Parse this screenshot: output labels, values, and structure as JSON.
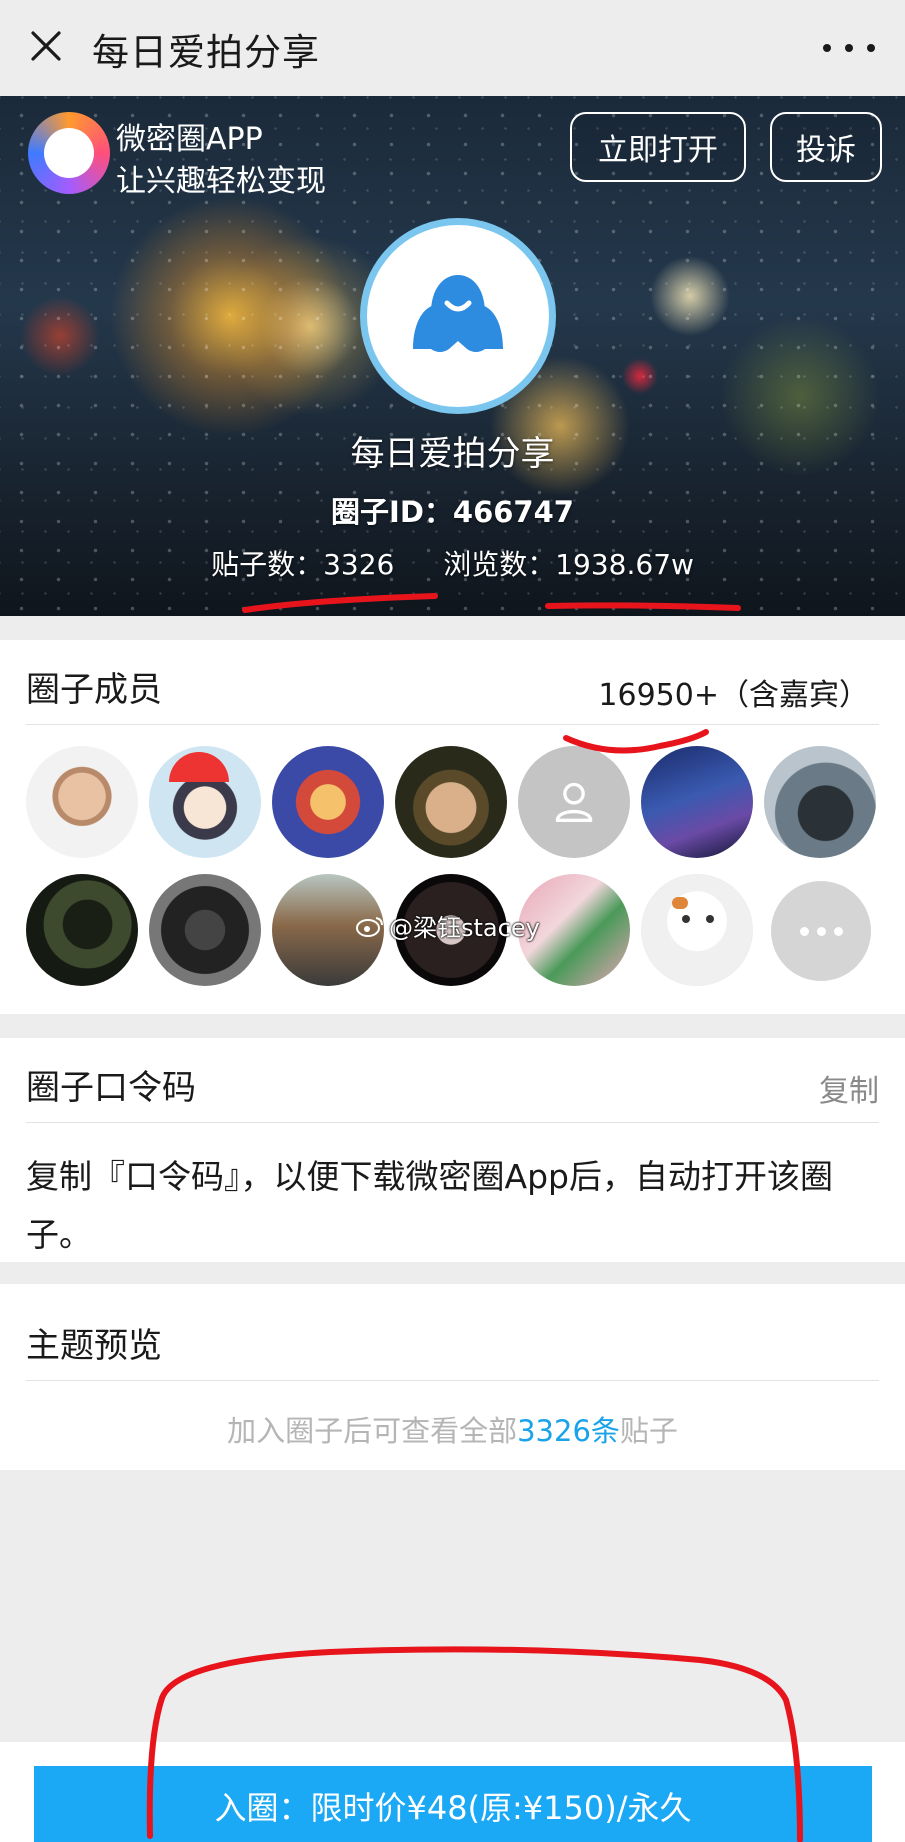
{
  "topbar": {
    "title": "每日爱拍分享",
    "close_icon": "close-icon",
    "more_icon": "more-horizontal-icon"
  },
  "hero": {
    "app_name": "微密圈APP",
    "app_slogan": "让兴趣轻松变现",
    "open_button": "立即打开",
    "report_button": "投诉",
    "group_name": "每日爱拍分享",
    "group_id": "圈子ID：466747",
    "posts": "贴子数：3326",
    "views": "浏览数：1938.67w"
  },
  "members": {
    "title": "圈子成员",
    "count": "16950+（含嘉宾）",
    "avatars": [
      "member-avatar-1",
      "member-avatar-2",
      "member-avatar-3",
      "member-avatar-4",
      "member-avatar-default",
      "member-avatar-6",
      "member-avatar-7",
      "member-avatar-8",
      "member-avatar-9",
      "member-avatar-10",
      "member-avatar-11",
      "member-avatar-12",
      "member-avatar-13",
      "more-members"
    ]
  },
  "watermark": "@梁钰stacey",
  "code": {
    "title": "圈子口令码",
    "copy": "复制",
    "desc": "复制『口令码』，以便下载微密圈App后，自动打开该圈子。"
  },
  "topic": {
    "title": "主题预览",
    "hint_prefix": "加入圈子后可查看全部",
    "hint_highlight": "3326条",
    "hint_suffix": "贴子"
  },
  "join": {
    "label": "入圈：限时价¥48(原:¥150)/永久"
  },
  "colors": {
    "accent": "#1ba8f4",
    "highlight_text": "#1aa3e8",
    "annotation_red": "#e8141c",
    "avatar_ring": "#7ac6ef"
  }
}
